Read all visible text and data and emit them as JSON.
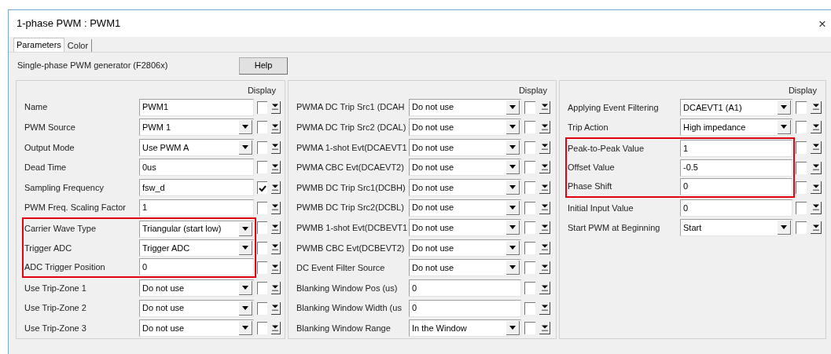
{
  "window": {
    "title": "1-phase PWM : PWM1",
    "close": "×"
  },
  "tabs": [
    {
      "label": "Parameters",
      "selected": true
    },
    {
      "label": "Color",
      "selected": false
    }
  ],
  "description": "Single-phase PWM generator (F2806x)",
  "help_button": "Help",
  "panels": [
    {
      "display_header": "Display",
      "rows": [
        {
          "label": "Name",
          "kind": "text",
          "value": "PWM1",
          "display": false,
          "highlighted": false
        },
        {
          "label": "PWM Source",
          "kind": "select",
          "value": "PWM 1",
          "display": false,
          "highlighted": false
        },
        {
          "label": "Output Mode",
          "kind": "select",
          "value": "Use PWM A",
          "display": false,
          "highlighted": false
        },
        {
          "label": "Dead Time",
          "kind": "text",
          "value": "0us",
          "display": false,
          "highlighted": false
        },
        {
          "label": "Sampling Frequency",
          "kind": "text",
          "value": "fsw_d",
          "display": true,
          "highlighted": false
        },
        {
          "label": "PWM Freq. Scaling Factor",
          "kind": "text",
          "value": "1",
          "display": false,
          "highlighted": false
        },
        {
          "label": "Carrier Wave Type",
          "kind": "select",
          "value": "Triangular (start low)",
          "display": false,
          "highlighted": true
        },
        {
          "label": "Trigger ADC",
          "kind": "select",
          "value": "Trigger ADC",
          "display": false,
          "highlighted": true
        },
        {
          "label": "ADC Trigger Position",
          "kind": "text",
          "value": "0",
          "display": false,
          "highlighted": true
        },
        {
          "label": "Use Trip-Zone 1",
          "kind": "select",
          "value": "Do not use",
          "display": false,
          "highlighted": false
        },
        {
          "label": "Use Trip-Zone 2",
          "kind": "select",
          "value": "Do not use",
          "display": false,
          "highlighted": false
        },
        {
          "label": "Use Trip-Zone 3",
          "kind": "select",
          "value": "Do not use",
          "display": false,
          "highlighted": false
        }
      ]
    },
    {
      "display_header": "Display",
      "rows": [
        {
          "label": "PWMA DC Trip Src1 (DCAH",
          "kind": "select",
          "value": "Do not use",
          "display": false,
          "highlighted": false
        },
        {
          "label": "PWMA DC Trip Src2 (DCAL)",
          "kind": "select",
          "value": "Do not use",
          "display": false,
          "highlighted": false
        },
        {
          "label": "PWMA 1-shot Evt(DCAEVT1",
          "kind": "select",
          "value": "Do not use",
          "display": false,
          "highlighted": false
        },
        {
          "label": "PWMA CBC Evt(DCAEVT2)",
          "kind": "select",
          "value": "Do not use",
          "display": false,
          "highlighted": false
        },
        {
          "label": "PWMB DC Trip Src1(DCBH)",
          "kind": "select",
          "value": "Do not use",
          "display": false,
          "highlighted": false
        },
        {
          "label": "PWMB DC Trip Src2(DCBL)",
          "kind": "select",
          "value": "Do not use",
          "display": false,
          "highlighted": false
        },
        {
          "label": "PWMB 1-shot Evt(DCBEVT1",
          "kind": "select",
          "value": "Do not use",
          "display": false,
          "highlighted": false
        },
        {
          "label": "PWMB CBC Evt(DCBEVT2)",
          "kind": "select",
          "value": "Do not use",
          "display": false,
          "highlighted": false
        },
        {
          "label": "DC Event Filter Source",
          "kind": "select",
          "value": "Do not use",
          "display": false,
          "highlighted": false
        },
        {
          "label": "Blanking Window Pos (us)",
          "kind": "text",
          "value": "0",
          "display": false,
          "highlighted": false
        },
        {
          "label": "Blanking Window Width (us",
          "kind": "text",
          "value": "0",
          "display": false,
          "highlighted": false
        },
        {
          "label": "Blanking Window Range",
          "kind": "select",
          "value": "In the Window",
          "display": false,
          "highlighted": false
        }
      ]
    },
    {
      "display_header": "Display",
      "rows": [
        {
          "label": "Applying Event Filtering",
          "kind": "select",
          "value": "DCAEVT1 (A1)",
          "display": false,
          "highlighted": false
        },
        {
          "label": "Trip Action",
          "kind": "select",
          "value": "High impedance",
          "display": false,
          "highlighted": false
        },
        {
          "label": "Peak-to-Peak Value",
          "kind": "text",
          "value": "1",
          "display": false,
          "highlighted": true
        },
        {
          "label": "Offset Value",
          "kind": "text",
          "value": "-0.5",
          "display": false,
          "highlighted": true
        },
        {
          "label": "Phase Shift",
          "kind": "text",
          "value": "0",
          "display": false,
          "highlighted": true
        },
        {
          "label": "Initial Input Value",
          "kind": "text",
          "value": "0",
          "display": false,
          "highlighted": false
        },
        {
          "label": "Start PWM at Beginning",
          "kind": "select",
          "value": "Start",
          "display": false,
          "highlighted": false
        }
      ]
    }
  ]
}
